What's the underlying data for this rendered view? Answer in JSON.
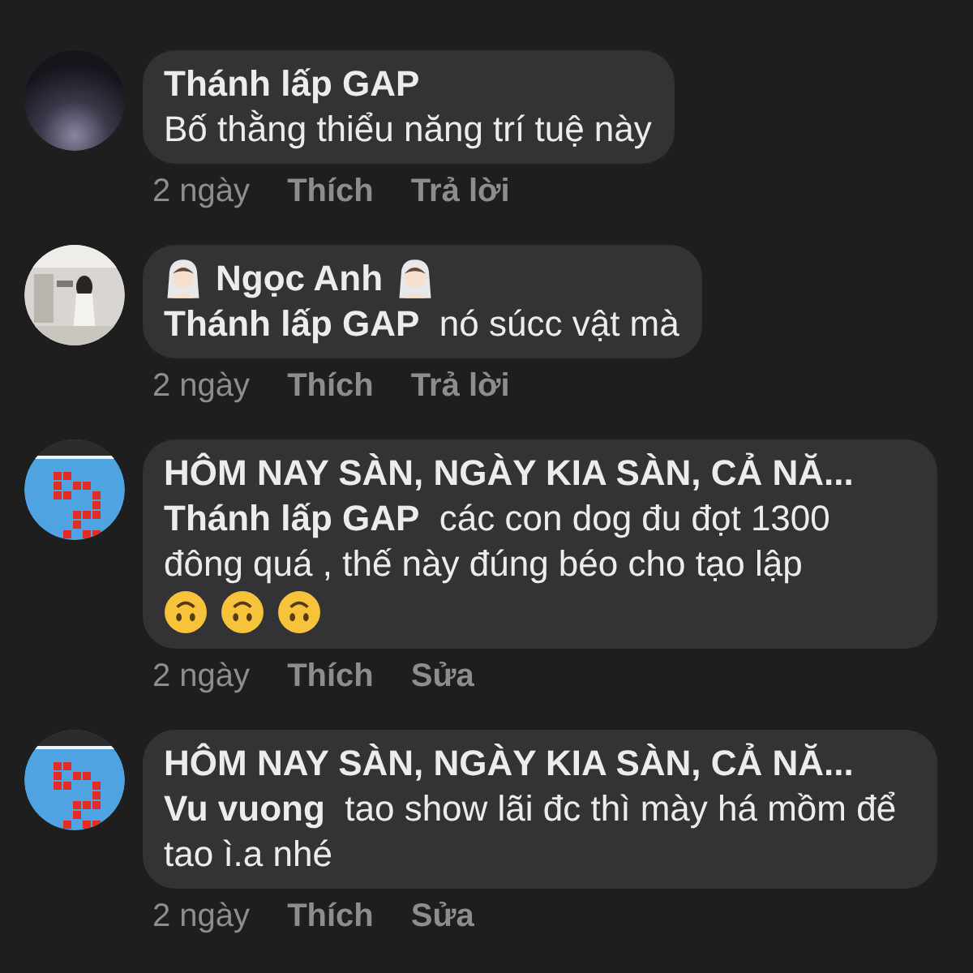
{
  "comments": [
    {
      "author": "Thánh lấp GAP",
      "text": "Bố thằng thiểu năng trí tuệ này",
      "time": "2 ngày",
      "like": "Thích",
      "action": "Trả lời"
    },
    {
      "author": "Ngọc Anh",
      "author_badge": {
        "kind": "bride"
      },
      "text": "**Thánh lấp GAP**  nó súcc vật mà",
      "time": "2 ngày",
      "like": "Thích",
      "action": "Trả lời"
    },
    {
      "author": "HÔM NAY SÀN, NGÀY KIA SÀN, CẢ NĂ...",
      "text": "**Thánh lấp GAP**  các con dog đu đọt 1300 đông quá , thế này đúng béo cho tạo lập",
      "trailing_icons": [
        {
          "kind": "upside-down-face"
        },
        {
          "kind": "upside-down-face"
        },
        {
          "kind": "upside-down-face"
        }
      ],
      "time": "2 ngày",
      "like": "Thích",
      "action": "Sửa"
    },
    {
      "author": "HÔM NAY SÀN, NGÀY KIA SÀN, CẢ NĂ...",
      "text": "**Vu vuong**  tao show lãi đc thì mày há mồm để tao ì.a nhé",
      "time": "2 ngày",
      "like": "Thích",
      "action": "Sửa"
    }
  ]
}
